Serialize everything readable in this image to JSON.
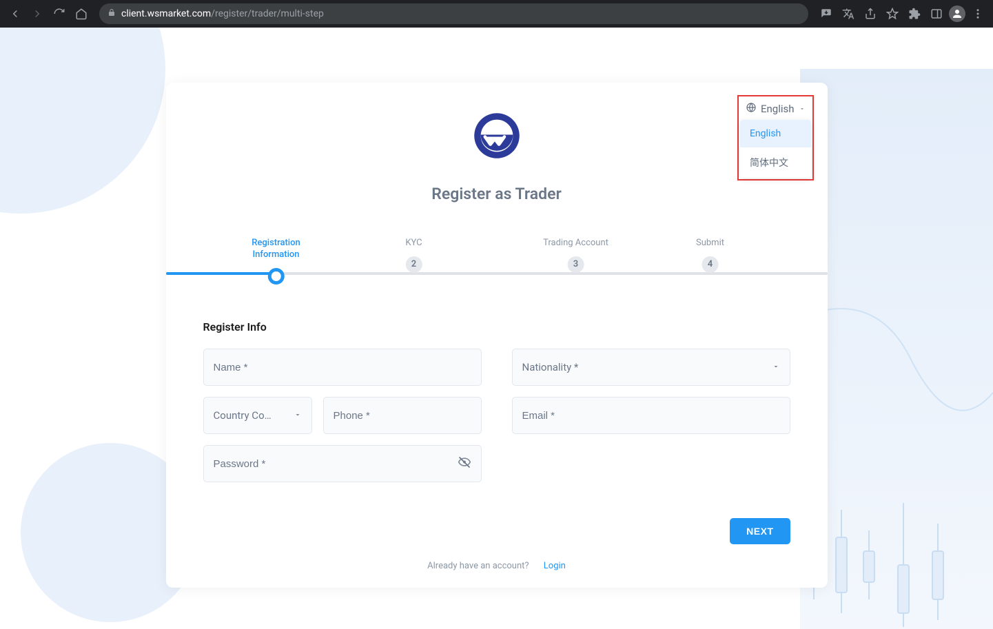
{
  "browser": {
    "url_host": "client.wsmarket.com",
    "url_path": "/register/trader/multi-step"
  },
  "language": {
    "current": "English",
    "options": [
      "English",
      "简体中文"
    ],
    "active_index": 0
  },
  "page": {
    "title": "Register as Trader"
  },
  "stepper": {
    "steps": [
      {
        "label": "Registration\nInformation",
        "number": ""
      },
      {
        "label": "KYC",
        "number": "2"
      },
      {
        "label": "Trading Account",
        "number": "3"
      },
      {
        "label": "Submit",
        "number": "4"
      }
    ],
    "active_index": 0
  },
  "form": {
    "section_label": "Register Info",
    "fields": {
      "name_placeholder": "Name *",
      "nationality_placeholder": "Nationality *",
      "country_code_placeholder": "Country Cod…",
      "phone_placeholder": "Phone *",
      "email_placeholder": "Email *",
      "password_placeholder": "Password *"
    }
  },
  "actions": {
    "next_label": "NEXT"
  },
  "footer": {
    "prompt": "Already have an account?",
    "login_label": "Login"
  },
  "colors": {
    "accent": "#2196f3",
    "highlight_border": "#e53935"
  }
}
